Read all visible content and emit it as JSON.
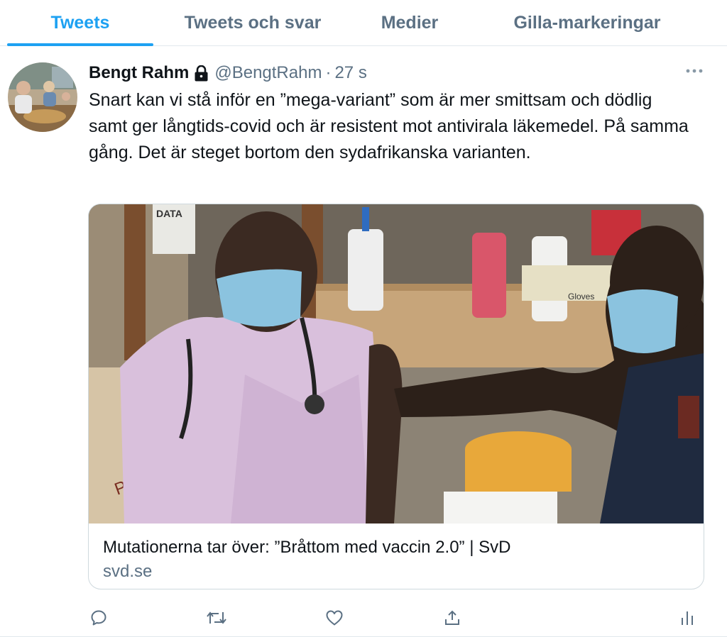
{
  "tabs": [
    {
      "label": "Tweets",
      "active": true
    },
    {
      "label": "Tweets och svar",
      "active": false
    },
    {
      "label": "Medier",
      "active": false
    },
    {
      "label": "Gilla-markeringar",
      "active": false
    }
  ],
  "tweet": {
    "author_name": "Bengt Rahm",
    "protected_icon": "lock-icon",
    "handle": "@BengtRahm",
    "separator": "·",
    "timestamp": "27 s",
    "text": "Snart kan vi stå inför en ”mega-variant” som är mer smittsam och dödlig samt ger långtids-covid och är resistent mot antivirala läkemedel. På samma gång. Det är steget bortom den sydafrikanska varianten.",
    "link_card": {
      "title": "Mutationerna tar över: ”Bråttom med vaccin 2.0” | SvD",
      "domain": "svd.se",
      "image_signs": {
        "sign1": "DATA",
        "sign2": "Phut",
        "gloves_label": "Gloves"
      }
    },
    "actions": [
      "reply-icon",
      "retweet-icon",
      "like-icon",
      "share-icon",
      "analytics-icon"
    ]
  },
  "colors": {
    "accent": "#1da1f2",
    "secondary_text": "#5b7083",
    "primary_text": "#0f1419",
    "border": "#e1e8ed"
  }
}
